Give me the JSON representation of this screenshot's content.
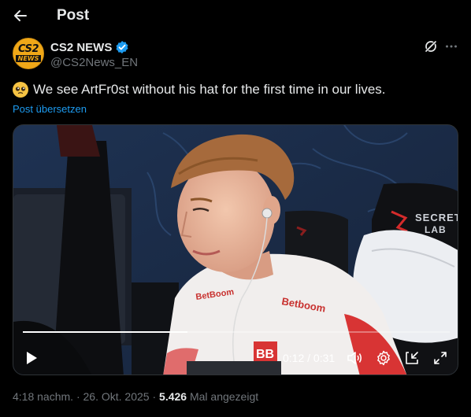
{
  "header": {
    "title": "Post"
  },
  "author": {
    "avatar_line1": "CS2",
    "avatar_line2": "NEWS",
    "name": "CS2 NEWS",
    "handle": "@CS2News_EN",
    "verified_color": "#1d9bf0"
  },
  "post": {
    "emoji": "pleading-face",
    "text": "We see ArtFr0st without his hat for the first time in our lives.",
    "translate_label": "Post übersetzen"
  },
  "video": {
    "current_time": "0:12",
    "separator": "/",
    "duration": "0:31",
    "progress_fraction": 0.385,
    "jersey_text": "Betboom",
    "chair_text_1": "SECRET",
    "chair_text_2": "LAB"
  },
  "meta": {
    "time": "4:18 nachm.",
    "separator": "·",
    "date": "26. Okt. 2025",
    "views_count": "5.426",
    "views_label": "Mal angezeigt"
  },
  "colors": {
    "accent": "#1d9bf0",
    "muted": "#71767b",
    "text": "#e7e9ea"
  }
}
